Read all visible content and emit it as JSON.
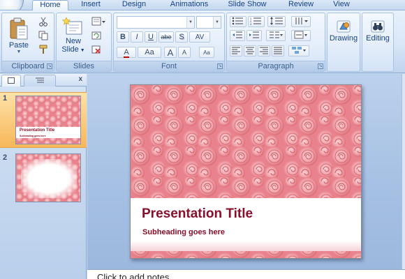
{
  "tabs": [
    "Home",
    "Insert",
    "Design",
    "Animations",
    "Slide Show",
    "Review",
    "View"
  ],
  "active_tab": "Home",
  "ribbon": {
    "groups": {
      "clipboard": "Clipboard",
      "slides": "Slides",
      "font": "Font",
      "paragraph": "Paragraph"
    },
    "paste_label": "Paste",
    "new_slide_label_1": "New",
    "new_slide_label_2": "Slide",
    "drawing_label": "Drawing",
    "editing_label": "Editing",
    "font_buttons": {
      "bold": "B",
      "italic": "I",
      "underline": "U",
      "strike": "abe",
      "shadow": "S",
      "spacing": "AV",
      "grow": "A",
      "shrink": "A",
      "change_case": "Aa",
      "font_color": "A",
      "clear": "Aa"
    },
    "font_name_value": "",
    "font_size_value": ""
  },
  "slides_pane": {
    "close_label": "x",
    "thumbnails": [
      {
        "number": "1",
        "title": "Presentation Title",
        "subtitle": "Subheading goes here",
        "selected": true
      },
      {
        "number": "2",
        "selected": false
      }
    ]
  },
  "slide": {
    "title": "Presentation Title",
    "subtitle": "Subheading goes  here"
  },
  "notes": {
    "placeholder": "Click to add notes"
  },
  "colors": {
    "title_red": "#8a0f2a",
    "rose_light": "#f7b7bc",
    "rose_dark": "#d9626e",
    "selection_orange": "#f7b75a"
  }
}
